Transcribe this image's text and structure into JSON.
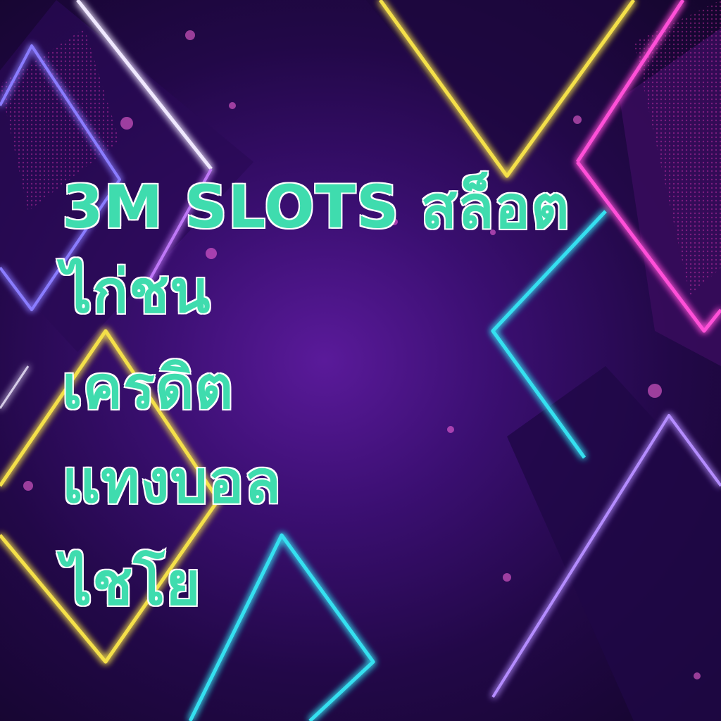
{
  "headline": {
    "lines": [
      "3M SLOTS สล็อต",
      "ไก่ชน",
      "เครดิต",
      "แทงบอล",
      "ไชโย"
    ]
  },
  "colors": {
    "text_fill": "#3fdcae",
    "text_outline": "#ffffff",
    "background": "#2a0a5a",
    "neon_yellow": "#f4e04a",
    "neon_cyan": "#36e0f0",
    "neon_magenta": "#ff4fd8",
    "neon_violet": "#b48cff"
  }
}
